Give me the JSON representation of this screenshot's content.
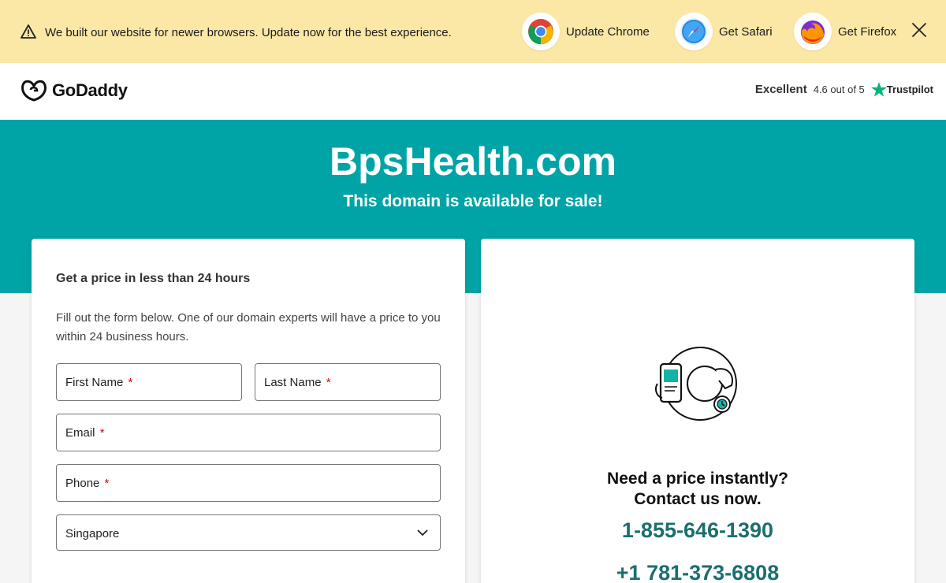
{
  "banner": {
    "message": "We built our website for newer browsers. Update now for the best experience.",
    "chrome_label": "Update Chrome",
    "safari_label": "Get Safari",
    "firefox_label": "Get Firefox",
    "bg_color": "#fbe8a6"
  },
  "header": {
    "logo_text": "GoDaddy",
    "rating_label": "Excellent",
    "rating_score": "4.6 out of 5",
    "trustpilot_label": "Trustpilot"
  },
  "hero": {
    "domain": "BpsHealth.com",
    "subtitle": "This domain is available for sale!",
    "bg_color": "#00a4a6"
  },
  "form": {
    "title": "Get a price in less than 24 hours",
    "description": "Fill out the form below. One of our domain experts will have a price to you within 24 business hours.",
    "first_name_placeholder": "First Name",
    "last_name_placeholder": "Last Name",
    "email_placeholder": "Email",
    "phone_placeholder": "Phone",
    "required_mark": "*",
    "country_value": "Singapore"
  },
  "contact": {
    "line1": "Need a price instantly?",
    "line2": "Contact us now.",
    "phone1": "1-855-646-1390",
    "phone2": "+1 781-373-6808",
    "phone_color": "#1b6f6f"
  },
  "icons": [
    "warning-icon",
    "chrome-icon",
    "safari-icon",
    "firefox-icon",
    "close-icon",
    "godaddy-logo-icon",
    "trustpilot-star-icon",
    "chevron-down-icon",
    "phone-illustration-icon"
  ]
}
